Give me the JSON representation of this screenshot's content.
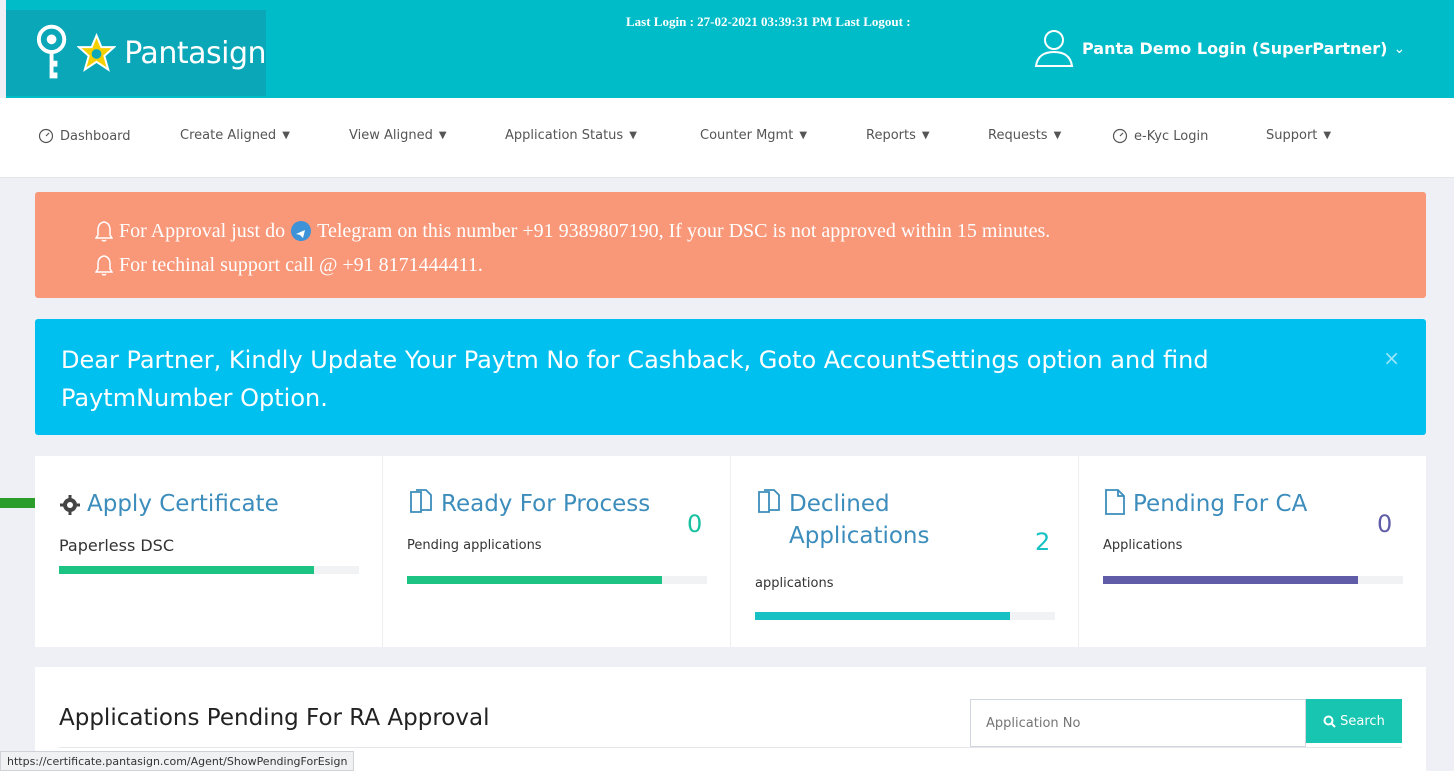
{
  "header": {
    "logo_text": "Pantasign",
    "last_login": "Last Login : 27-02-2021 03:39:31 PM   Last Logout :",
    "user_name": "Panta Demo Login (SuperPartner)"
  },
  "nav": {
    "items": [
      {
        "label": "Dashboard",
        "icon": "gauge-icon",
        "dropdown": false
      },
      {
        "label": "Create Aligned",
        "dropdown": true
      },
      {
        "label": "View Aligned",
        "dropdown": true
      },
      {
        "label": "Application Status",
        "dropdown": true
      },
      {
        "label": "Counter Mgmt",
        "dropdown": true
      },
      {
        "label": "Reports",
        "dropdown": true
      },
      {
        "label": "Requests",
        "dropdown": true
      },
      {
        "label": "e-Kyc Login",
        "icon": "gauge-icon",
        "dropdown": false
      },
      {
        "label": "Support",
        "dropdown": true
      }
    ]
  },
  "alerts": {
    "approval_pre": "For Approval just do",
    "approval_post": "Telegram on this number +91 9389807190, If your DSC is not approved within 15 minutes.",
    "support": "For techinal support call @ +91 8171444411.",
    "paytm": "Dear Partner, Kindly Update Your Paytm No for Cashback, Goto AccountSettings option and find PaytmNumber Option.",
    "close": "×"
  },
  "cards": [
    {
      "title": "Apply Certificate",
      "subtitle": "Paperless DSC",
      "count": "",
      "progress": 0.85,
      "bar_color": "#1cc383",
      "icon": "gear-icon"
    },
    {
      "title": "Ready For Process",
      "subtitle": "Pending applications",
      "count": "0",
      "progress": 0.85,
      "bar_color": "#1cc383",
      "icon": "files-icon"
    },
    {
      "title": "Declined Applications",
      "subtitle": "applications",
      "count": "2",
      "progress": 0.85,
      "bar_color": "#17c1c3",
      "icon": "files-icon"
    },
    {
      "title": "Pending For CA",
      "subtitle": "Applications",
      "count": "0",
      "progress": 0.85,
      "bar_color": "#605ca8",
      "icon": "file-icon"
    }
  ],
  "panel": {
    "title": "Applications Pending For RA Approval",
    "search_placeholder": "Application No",
    "search_label": "Search"
  },
  "status_url": "https://certificate.pantasign.com/Agent/ShowPendingForEsign"
}
